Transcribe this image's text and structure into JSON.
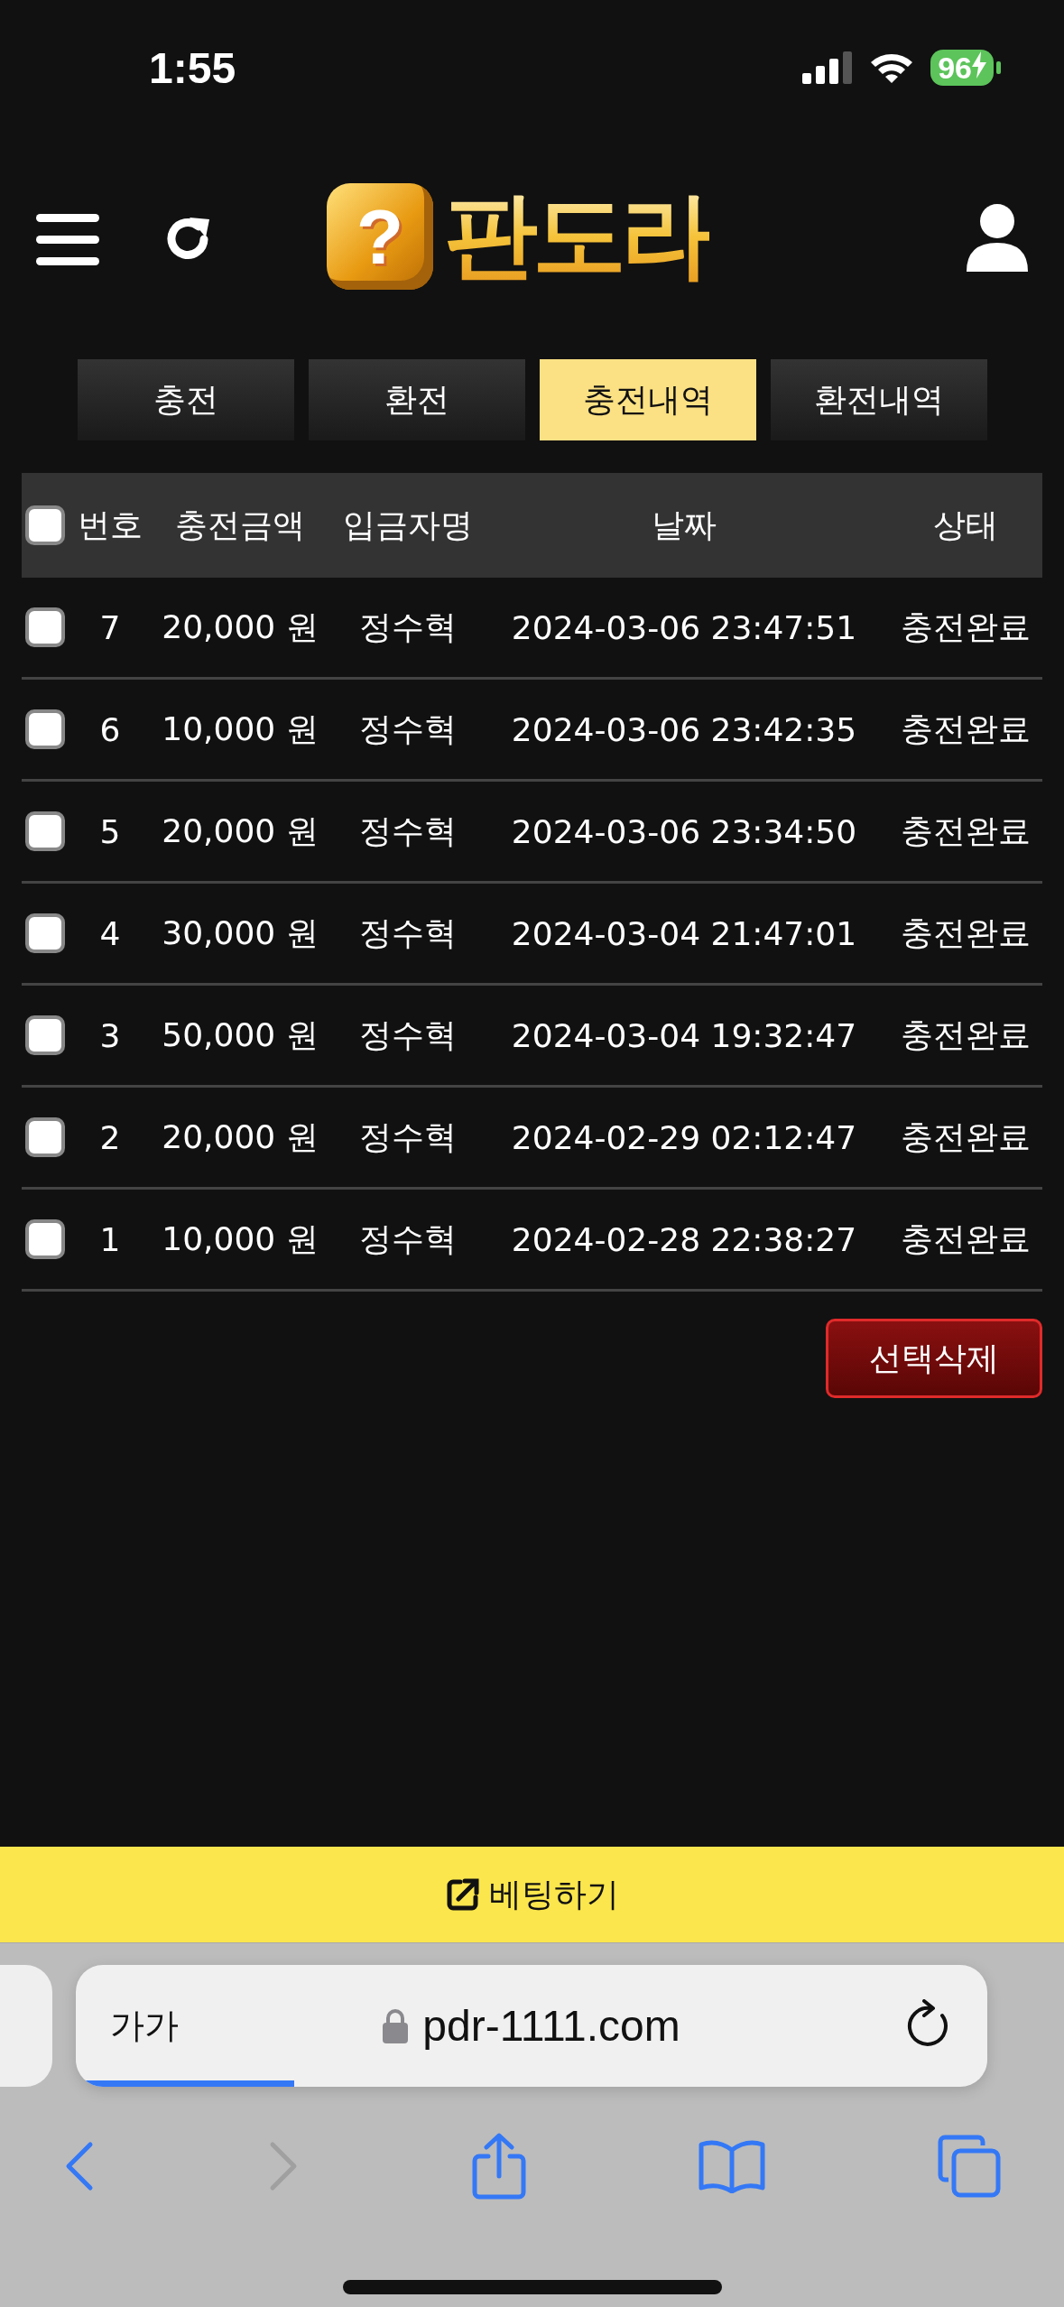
{
  "status_bar": {
    "time": "1:55",
    "battery": "96"
  },
  "header": {
    "logo": {
      "mark": "?",
      "text": "판도라"
    }
  },
  "tabs": [
    {
      "label": "충전",
      "selected": false
    },
    {
      "label": "환전",
      "selected": false
    },
    {
      "label": "충전내역",
      "selected": true
    },
    {
      "label": "환전내역",
      "selected": false
    }
  ],
  "table": {
    "select_all": {
      "checked": false
    },
    "columns": [
      "번호",
      "충전금액",
      "입금자명",
      "날짜",
      "상태"
    ],
    "rows": [
      {
        "checked": false,
        "cells": [
          "7",
          "20,000 원",
          "정수혁",
          "2024-03-06 23:47:51",
          "충전완료"
        ]
      },
      {
        "checked": false,
        "cells": [
          "6",
          "10,000 원",
          "정수혁",
          "2024-03-06 23:42:35",
          "충전완료"
        ]
      },
      {
        "checked": false,
        "cells": [
          "5",
          "20,000 원",
          "정수혁",
          "2024-03-06 23:34:50",
          "충전완료"
        ]
      },
      {
        "checked": false,
        "cells": [
          "4",
          "30,000 원",
          "정수혁",
          "2024-03-04 21:47:01",
          "충전완료"
        ]
      },
      {
        "checked": false,
        "cells": [
          "3",
          "50,000 원",
          "정수혁",
          "2024-03-04 19:32:47",
          "충전완료"
        ]
      },
      {
        "checked": false,
        "cells": [
          "2",
          "20,000 원",
          "정수혁",
          "2024-02-29 02:12:47",
          "충전완료"
        ]
      },
      {
        "checked": false,
        "cells": [
          "1",
          "10,000 원",
          "정수혁",
          "2024-02-28 22:38:27",
          "충전완료"
        ]
      }
    ]
  },
  "delete_button": {
    "label": "선택삭제"
  },
  "bet_bar": {
    "label": "베팅하기"
  },
  "browser": {
    "text_size": "가가",
    "url": "pdr-1111.com",
    "progress": {
      "level": 0.24
    },
    "back_disabled": false,
    "forward_disabled": true
  }
}
